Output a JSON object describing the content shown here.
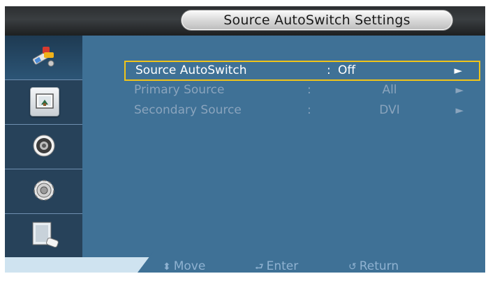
{
  "window": {
    "title": "Source AutoSwitch Settings"
  },
  "sidebar": {
    "items": [
      {
        "icon": "input-connector-icon",
        "active": true
      },
      {
        "icon": "picture-icon",
        "active": false
      },
      {
        "icon": "sound-icon",
        "active": false
      },
      {
        "icon": "setup-gear-icon",
        "active": false
      },
      {
        "icon": "multi-control-icon",
        "active": false
      }
    ]
  },
  "menu": {
    "rows": [
      {
        "label": "Source AutoSwitch",
        "colon": ":",
        "value": "Off",
        "arrow": "►",
        "selected": true,
        "enabled": true
      },
      {
        "label": "Primary Source",
        "colon": ":",
        "value": "All",
        "arrow": "►",
        "selected": false,
        "enabled": false
      },
      {
        "label": "Secondary Source",
        "colon": ":",
        "value": "DVI",
        "arrow": "►",
        "selected": false,
        "enabled": false
      }
    ]
  },
  "footer": {
    "move": {
      "glyph": "⬍",
      "label": "Move"
    },
    "enter": {
      "glyph": "⮐",
      "label": "Enter"
    },
    "return": {
      "glyph": "↺",
      "label": "Return"
    }
  },
  "colors": {
    "background": "#3f7196",
    "sidebar": "#27425a",
    "selection_border": "#f0c419",
    "disabled_text": "#8aa4bd",
    "footer_text": "#8fb2d1"
  }
}
